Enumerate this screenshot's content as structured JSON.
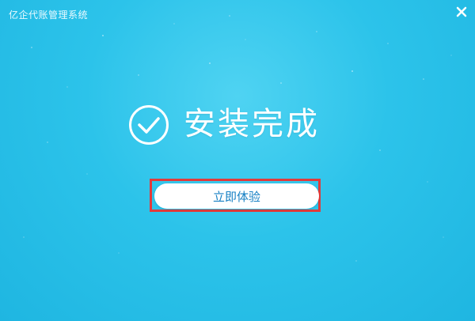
{
  "window": {
    "title": "亿企代账管理系统"
  },
  "status": {
    "complete_text": "安装完成"
  },
  "actions": {
    "experience_label": "立即体验"
  },
  "icons": {
    "close": "close-icon",
    "check": "check-circle-icon"
  },
  "colors": {
    "background": "#2cc3ea",
    "button_text": "#1780c4",
    "highlight_border": "#e23b3b"
  }
}
